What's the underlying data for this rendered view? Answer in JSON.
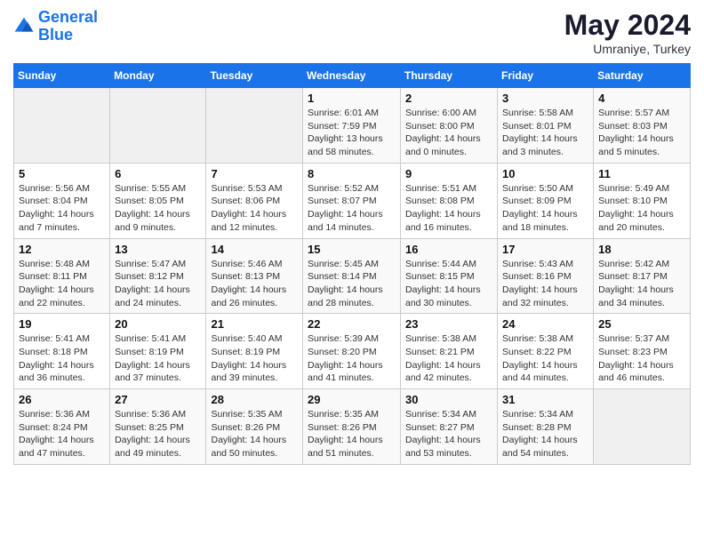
{
  "header": {
    "logo_line1": "General",
    "logo_line2": "Blue",
    "title": "May 2024",
    "subtitle": "Umraniye, Turkey"
  },
  "weekdays": [
    "Sunday",
    "Monday",
    "Tuesday",
    "Wednesday",
    "Thursday",
    "Friday",
    "Saturday"
  ],
  "weeks": [
    [
      {
        "day": "",
        "sunrise": "",
        "sunset": "",
        "daylight": ""
      },
      {
        "day": "",
        "sunrise": "",
        "sunset": "",
        "daylight": ""
      },
      {
        "day": "",
        "sunrise": "",
        "sunset": "",
        "daylight": ""
      },
      {
        "day": "1",
        "sunrise": "Sunrise: 6:01 AM",
        "sunset": "Sunset: 7:59 PM",
        "daylight": "Daylight: 13 hours and 58 minutes."
      },
      {
        "day": "2",
        "sunrise": "Sunrise: 6:00 AM",
        "sunset": "Sunset: 8:00 PM",
        "daylight": "Daylight: 14 hours and 0 minutes."
      },
      {
        "day": "3",
        "sunrise": "Sunrise: 5:58 AM",
        "sunset": "Sunset: 8:01 PM",
        "daylight": "Daylight: 14 hours and 3 minutes."
      },
      {
        "day": "4",
        "sunrise": "Sunrise: 5:57 AM",
        "sunset": "Sunset: 8:03 PM",
        "daylight": "Daylight: 14 hours and 5 minutes."
      }
    ],
    [
      {
        "day": "5",
        "sunrise": "Sunrise: 5:56 AM",
        "sunset": "Sunset: 8:04 PM",
        "daylight": "Daylight: 14 hours and 7 minutes."
      },
      {
        "day": "6",
        "sunrise": "Sunrise: 5:55 AM",
        "sunset": "Sunset: 8:05 PM",
        "daylight": "Daylight: 14 hours and 9 minutes."
      },
      {
        "day": "7",
        "sunrise": "Sunrise: 5:53 AM",
        "sunset": "Sunset: 8:06 PM",
        "daylight": "Daylight: 14 hours and 12 minutes."
      },
      {
        "day": "8",
        "sunrise": "Sunrise: 5:52 AM",
        "sunset": "Sunset: 8:07 PM",
        "daylight": "Daylight: 14 hours and 14 minutes."
      },
      {
        "day": "9",
        "sunrise": "Sunrise: 5:51 AM",
        "sunset": "Sunset: 8:08 PM",
        "daylight": "Daylight: 14 hours and 16 minutes."
      },
      {
        "day": "10",
        "sunrise": "Sunrise: 5:50 AM",
        "sunset": "Sunset: 8:09 PM",
        "daylight": "Daylight: 14 hours and 18 minutes."
      },
      {
        "day": "11",
        "sunrise": "Sunrise: 5:49 AM",
        "sunset": "Sunset: 8:10 PM",
        "daylight": "Daylight: 14 hours and 20 minutes."
      }
    ],
    [
      {
        "day": "12",
        "sunrise": "Sunrise: 5:48 AM",
        "sunset": "Sunset: 8:11 PM",
        "daylight": "Daylight: 14 hours and 22 minutes."
      },
      {
        "day": "13",
        "sunrise": "Sunrise: 5:47 AM",
        "sunset": "Sunset: 8:12 PM",
        "daylight": "Daylight: 14 hours and 24 minutes."
      },
      {
        "day": "14",
        "sunrise": "Sunrise: 5:46 AM",
        "sunset": "Sunset: 8:13 PM",
        "daylight": "Daylight: 14 hours and 26 minutes."
      },
      {
        "day": "15",
        "sunrise": "Sunrise: 5:45 AM",
        "sunset": "Sunset: 8:14 PM",
        "daylight": "Daylight: 14 hours and 28 minutes."
      },
      {
        "day": "16",
        "sunrise": "Sunrise: 5:44 AM",
        "sunset": "Sunset: 8:15 PM",
        "daylight": "Daylight: 14 hours and 30 minutes."
      },
      {
        "day": "17",
        "sunrise": "Sunrise: 5:43 AM",
        "sunset": "Sunset: 8:16 PM",
        "daylight": "Daylight: 14 hours and 32 minutes."
      },
      {
        "day": "18",
        "sunrise": "Sunrise: 5:42 AM",
        "sunset": "Sunset: 8:17 PM",
        "daylight": "Daylight: 14 hours and 34 minutes."
      }
    ],
    [
      {
        "day": "19",
        "sunrise": "Sunrise: 5:41 AM",
        "sunset": "Sunset: 8:18 PM",
        "daylight": "Daylight: 14 hours and 36 minutes."
      },
      {
        "day": "20",
        "sunrise": "Sunrise: 5:41 AM",
        "sunset": "Sunset: 8:19 PM",
        "daylight": "Daylight: 14 hours and 37 minutes."
      },
      {
        "day": "21",
        "sunrise": "Sunrise: 5:40 AM",
        "sunset": "Sunset: 8:19 PM",
        "daylight": "Daylight: 14 hours and 39 minutes."
      },
      {
        "day": "22",
        "sunrise": "Sunrise: 5:39 AM",
        "sunset": "Sunset: 8:20 PM",
        "daylight": "Daylight: 14 hours and 41 minutes."
      },
      {
        "day": "23",
        "sunrise": "Sunrise: 5:38 AM",
        "sunset": "Sunset: 8:21 PM",
        "daylight": "Daylight: 14 hours and 42 minutes."
      },
      {
        "day": "24",
        "sunrise": "Sunrise: 5:38 AM",
        "sunset": "Sunset: 8:22 PM",
        "daylight": "Daylight: 14 hours and 44 minutes."
      },
      {
        "day": "25",
        "sunrise": "Sunrise: 5:37 AM",
        "sunset": "Sunset: 8:23 PM",
        "daylight": "Daylight: 14 hours and 46 minutes."
      }
    ],
    [
      {
        "day": "26",
        "sunrise": "Sunrise: 5:36 AM",
        "sunset": "Sunset: 8:24 PM",
        "daylight": "Daylight: 14 hours and 47 minutes."
      },
      {
        "day": "27",
        "sunrise": "Sunrise: 5:36 AM",
        "sunset": "Sunset: 8:25 PM",
        "daylight": "Daylight: 14 hours and 49 minutes."
      },
      {
        "day": "28",
        "sunrise": "Sunrise: 5:35 AM",
        "sunset": "Sunset: 8:26 PM",
        "daylight": "Daylight: 14 hours and 50 minutes."
      },
      {
        "day": "29",
        "sunrise": "Sunrise: 5:35 AM",
        "sunset": "Sunset: 8:26 PM",
        "daylight": "Daylight: 14 hours and 51 minutes."
      },
      {
        "day": "30",
        "sunrise": "Sunrise: 5:34 AM",
        "sunset": "Sunset: 8:27 PM",
        "daylight": "Daylight: 14 hours and 53 minutes."
      },
      {
        "day": "31",
        "sunrise": "Sunrise: 5:34 AM",
        "sunset": "Sunset: 8:28 PM",
        "daylight": "Daylight: 14 hours and 54 minutes."
      },
      {
        "day": "",
        "sunrise": "",
        "sunset": "",
        "daylight": ""
      }
    ]
  ]
}
